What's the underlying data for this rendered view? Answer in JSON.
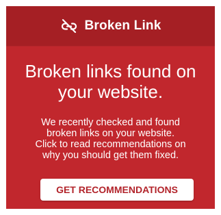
{
  "theme": {
    "card_bg": "#c1272d",
    "header_bg": "#a51f24",
    "button_bg": "#ffffff",
    "button_text": "#b2232a"
  },
  "header": {
    "icon": "broken-link-icon",
    "title": "Broken Link"
  },
  "content": {
    "headline": "Broken links found on your website.",
    "body": "We recently checked and found broken links on your website. Click to read recommendations on why you should get them fixed."
  },
  "cta": {
    "label": "GET RECOMMENDATIONS"
  }
}
